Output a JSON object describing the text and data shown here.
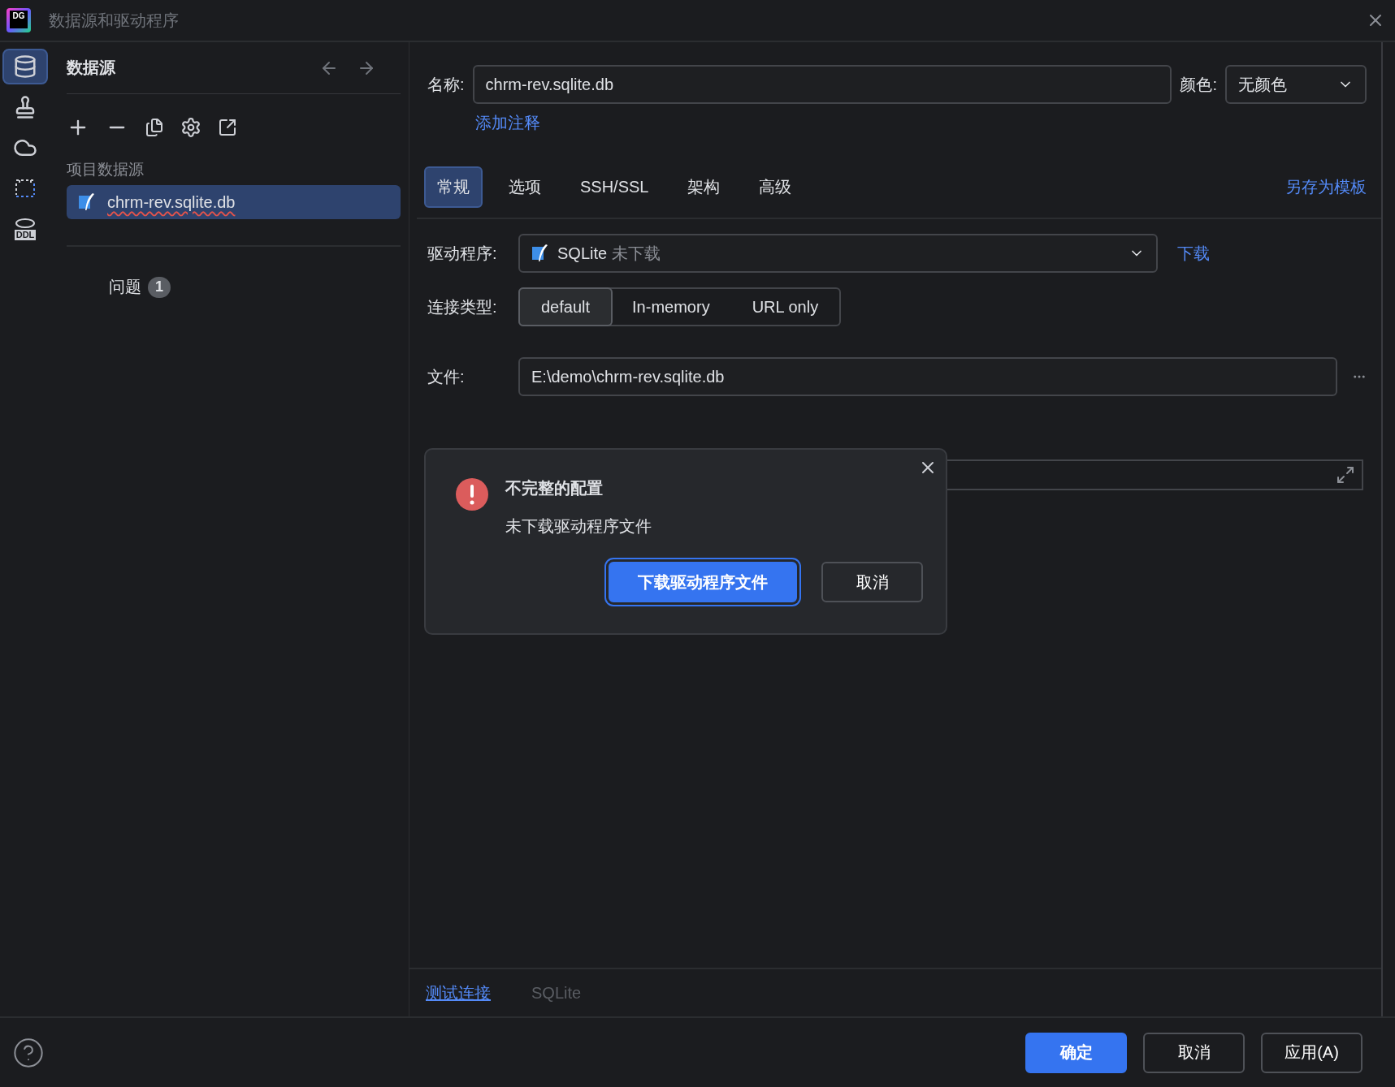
{
  "window": {
    "logo": "DG",
    "title": "数据源和驱动程序"
  },
  "rail": [
    {
      "kind": "database",
      "selected": true
    },
    {
      "kind": "stamp",
      "selected": false
    },
    {
      "kind": "cloud",
      "selected": false
    },
    {
      "kind": "frame",
      "selected": false
    },
    {
      "kind": "ddl",
      "label": "DDL",
      "selected": false
    }
  ],
  "left_panel": {
    "title": "数据源",
    "group_label": "项目数据源",
    "items": [
      {
        "label": "chrm-rev.sqlite.db",
        "selected": true,
        "error": true
      }
    ],
    "problems": {
      "label": "问题",
      "count": "1"
    }
  },
  "form": {
    "name": {
      "label": "名称:",
      "value": "chrm-rev.sqlite.db"
    },
    "add_comment": "添加注释",
    "color": {
      "label": "颜色:",
      "value": "无颜色"
    },
    "tabs": [
      {
        "label": "常规",
        "selected": true
      },
      {
        "label": "选项",
        "selected": false
      },
      {
        "label": "SSH/SSL",
        "selected": false
      },
      {
        "label": "架构",
        "selected": false
      },
      {
        "label": "高级",
        "selected": false
      }
    ],
    "save_template": "另存为模板",
    "driver": {
      "label": "驱动程序:",
      "name": "SQLite",
      "status": "未下载",
      "download": "下载"
    },
    "connection_type": {
      "label": "连接类型:",
      "options": [
        {
          "label": "default",
          "selected": true
        },
        {
          "label": "In-memory",
          "selected": false
        },
        {
          "label": "URL only",
          "selected": false
        }
      ]
    },
    "file": {
      "label": "文件:",
      "value": "E:\\demo\\chrm-rev.sqlite.db"
    },
    "test_connection": "测试连接",
    "driver_name": "SQLite"
  },
  "dialog": {
    "title": "不完整的配置",
    "message": "未下载驱动程序文件",
    "buttons": [
      {
        "label": "下载驱动程序文件",
        "primary": true
      },
      {
        "label": "取消",
        "primary": false
      }
    ]
  },
  "footer": {
    "buttons": [
      {
        "label": "确定",
        "primary": true
      },
      {
        "label": "取消",
        "primary": false
      },
      {
        "label": "应用(A)",
        "primary": false
      }
    ]
  }
}
